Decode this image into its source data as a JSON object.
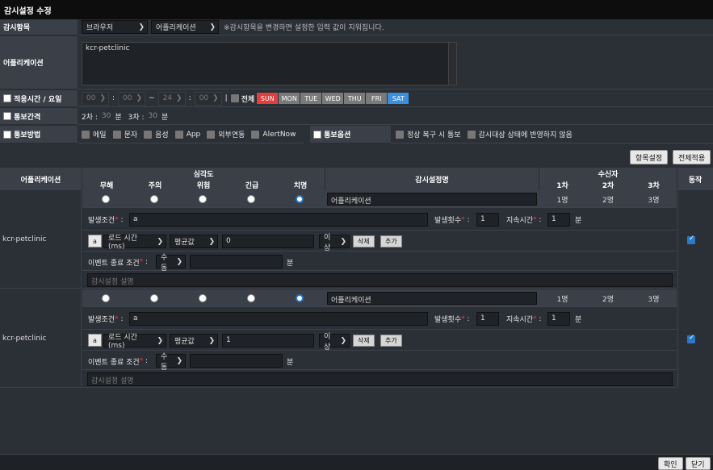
{
  "title": "감시설정 수정",
  "form": {
    "monitor_item_label": "감시항목",
    "monitor_item_select1": "브라우저",
    "monitor_item_select2": "어플리케이션",
    "monitor_item_note": "※감시항목을 변경하면 설정한 입력 값이 지워집니다.",
    "application_label": "어플리케이션",
    "application_value": "kcr-petclinic",
    "apply_time_label": "적용시간 / 요일",
    "time_start_h": "00",
    "time_start_m": "00",
    "time_end_h": "24",
    "time_end_m": "00",
    "colon": ":",
    "tilde": "~",
    "pipe": "|",
    "all_label": "전체",
    "days": [
      "SUN",
      "MON",
      "TUE",
      "WED",
      "THU",
      "FRI",
      "SAT"
    ],
    "notify_interval_label": "통보간격",
    "second_label": "2차 :",
    "second_value": "30",
    "third_label": "3차 :",
    "third_value": "30",
    "minute_unit": "분",
    "notify_method_label": "통보방법",
    "methods": [
      "메일",
      "문자",
      "음성",
      "App",
      "외부연동",
      "AlertNow"
    ],
    "notify_option_label": "통보옵션",
    "option1": "정상 복구 시 통보",
    "option2": "감시대상 상태에 반영하지 않음"
  },
  "buttons": {
    "item_settings": "항목설정",
    "apply_all": "전체적용",
    "confirm": "확인",
    "close": "닫기",
    "delete": "삭제",
    "add": "추가"
  },
  "table": {
    "col_app": "어플리케이션",
    "col_severity": "심각도",
    "severities": [
      "무해",
      "주의",
      "위험",
      "긴급",
      "치명"
    ],
    "col_name": "감시설정명",
    "col_receivers": "수신자",
    "receiver_levels": [
      "1차",
      "2차",
      "3차"
    ],
    "col_enabled": "동작",
    "rows": [
      {
        "app": "kcr-petclinic",
        "name": "어플리케이션",
        "receivers": [
          "1명",
          "2명",
          "3명"
        ],
        "cond_label": "발생조건",
        "cond_value": "a",
        "count_label": "발생횟수",
        "count_value": "1",
        "duration_label": "지속시간",
        "duration_value": "1",
        "duration_unit": "분",
        "var": "a",
        "metric": "로드 시간 (ms)",
        "agg": "평균값",
        "threshold": "0",
        "op": "이상",
        "end_label": "이벤트 종료 조건",
        "end_mode": "수동",
        "end_unit": "분",
        "desc_placeholder": "감시설정 설명"
      },
      {
        "app": "kcr-petclinic",
        "name": "어플리케이션",
        "receivers": [
          "1명",
          "2명",
          "3명"
        ],
        "cond_label": "발생조건",
        "cond_value": "a",
        "count_label": "발생횟수",
        "count_value": "1",
        "duration_label": "지속시간",
        "duration_value": "1",
        "duration_unit": "분",
        "var": "a",
        "metric": "로드 시간 (ms)",
        "agg": "평균값",
        "threshold": "1",
        "op": "이상",
        "end_label": "이벤트 종료 조건",
        "end_mode": "수동",
        "end_unit": "분",
        "desc_placeholder": "감시설정 설명"
      }
    ]
  },
  "colors": {
    "sun": "#e0403d",
    "sat": "#3b8fe0",
    "weekday": "#7a7a7a"
  }
}
